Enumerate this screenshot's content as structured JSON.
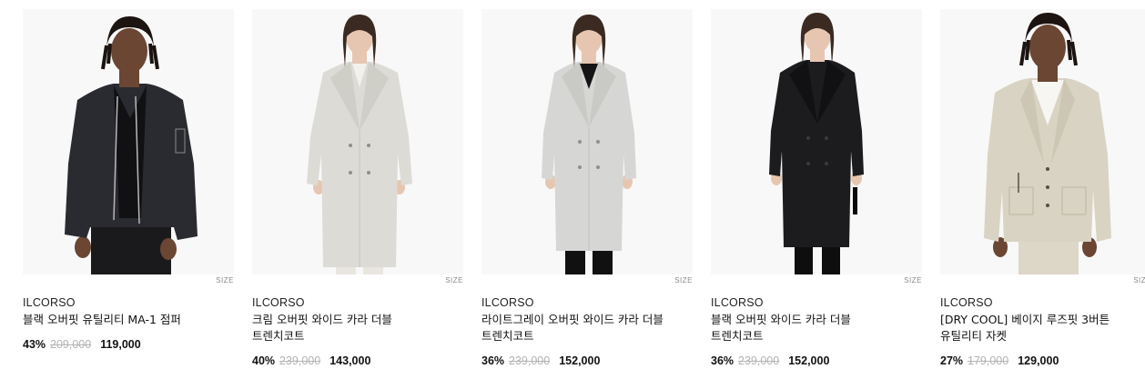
{
  "size_label": "SIZE",
  "products": [
    {
      "brand": "ILCORSO",
      "name": "블랙 오버핏 유틸리티 MA-1 점퍼",
      "discount": "43%",
      "original_price": "209,000",
      "price": "119,000",
      "garment_color": "#2a2b30"
    },
    {
      "brand": "ILCORSO",
      "name": "크림 오버핏 와이드 카라 더블 트렌치코트",
      "discount": "40%",
      "original_price": "239,000",
      "price": "143,000",
      "garment_color": "#dcdbd5"
    },
    {
      "brand": "ILCORSO",
      "name": "라이트그레이 오버핏 와이드 카라 더블 트렌치코트",
      "discount": "36%",
      "original_price": "239,000",
      "price": "152,000",
      "garment_color": "#d6d7d4"
    },
    {
      "brand": "ILCORSO",
      "name": "블랙 오버핏 와이드 카라 더블 트렌치코트",
      "discount": "36%",
      "original_price": "239,000",
      "price": "152,000",
      "garment_color": "#1c1c1e"
    },
    {
      "brand": "ILCORSO",
      "name": "[DRY COOL] 베이지 루즈핏 3버튼 유틸리티 자켓",
      "discount": "27%",
      "original_price": "179,000",
      "price": "129,000",
      "garment_color": "#d9d3c3"
    }
  ]
}
